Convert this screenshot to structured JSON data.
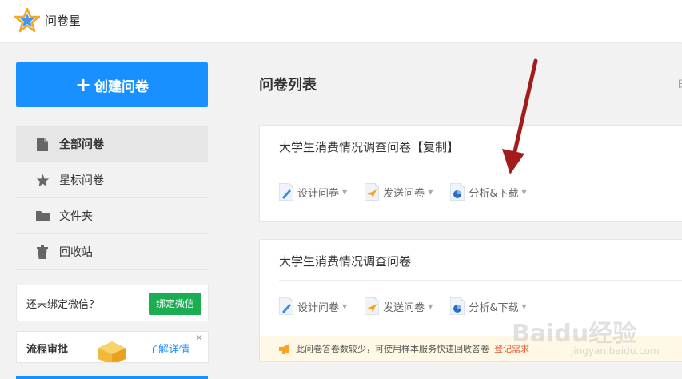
{
  "header": {
    "logo_text": "问卷星"
  },
  "sidebar": {
    "create_label": "创建问卷",
    "items": [
      {
        "label": "全部问卷",
        "icon": "document-icon",
        "active": true
      },
      {
        "label": "星标问卷",
        "icon": "star-icon",
        "active": false
      },
      {
        "label": "文件夹",
        "icon": "folder-icon",
        "active": false
      },
      {
        "label": "回收站",
        "icon": "trash-icon",
        "active": false
      }
    ],
    "wechat": {
      "text": "还未绑定微信？",
      "button": "绑定微信"
    },
    "flow": {
      "title": "流程审批",
      "link": "了解详情",
      "close": "×"
    }
  },
  "main": {
    "title": "问卷列表",
    "edge_text": "日",
    "cards": [
      {
        "title": "大学生消费情况调查问卷【复制】",
        "actions": [
          "设计问卷",
          "发送问卷",
          "分析&下载"
        ]
      },
      {
        "title": "大学生消费情况调查问卷",
        "actions": [
          "设计问卷",
          "发送问卷",
          "分析&下载"
        ],
        "notice": "此问卷答卷数较少，可使用样本服务快速回收答卷",
        "notice_link": "登记需求"
      }
    ]
  },
  "watermark": {
    "main": "Baidu经验",
    "sub": "jingyan.baidu.com"
  },
  "colors": {
    "primary": "#1890ff",
    "wechat": "#1aad52",
    "arrow": "#a31b1b",
    "notice_bg": "#fff8e6",
    "notice_link": "#e4572e"
  }
}
